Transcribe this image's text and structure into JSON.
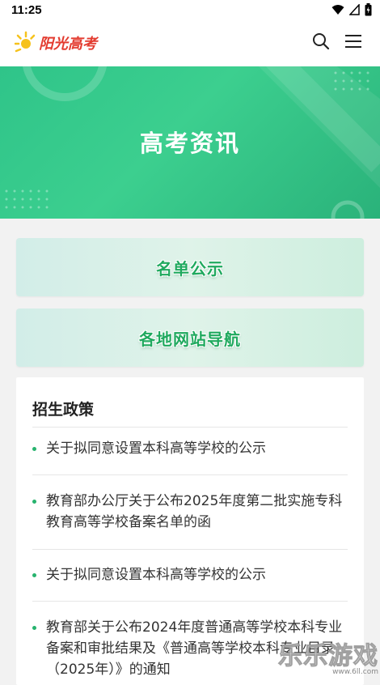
{
  "status_bar": {
    "time": "11:25"
  },
  "header": {
    "logo_text": "阳光高考"
  },
  "hero": {
    "title": "高考资讯"
  },
  "nav_cards": [
    {
      "label": "名单公示"
    },
    {
      "label": "各地网站导航"
    }
  ],
  "policy": {
    "heading": "招生政策",
    "items": [
      {
        "text": "关于拟同意设置本科高等学校的公示"
      },
      {
        "text": "教育部办公厅关于公布2025年度第二批实施专科教育高等学校备案名单的函"
      },
      {
        "text": "关于拟同意设置本科高等学校的公示"
      },
      {
        "text": "教育部关于公布2024年度普通高等学校本科专业备案和审批结果及《普通高等学校本科专业目录（2025年）》的通知"
      }
    ]
  },
  "watermark": {
    "text": "乐乐游戏",
    "url": "www.6ll.com"
  },
  "colors": {
    "accent": "#2fc489",
    "brand_logo": "#e33b2f",
    "bullet": "#27b36e"
  }
}
